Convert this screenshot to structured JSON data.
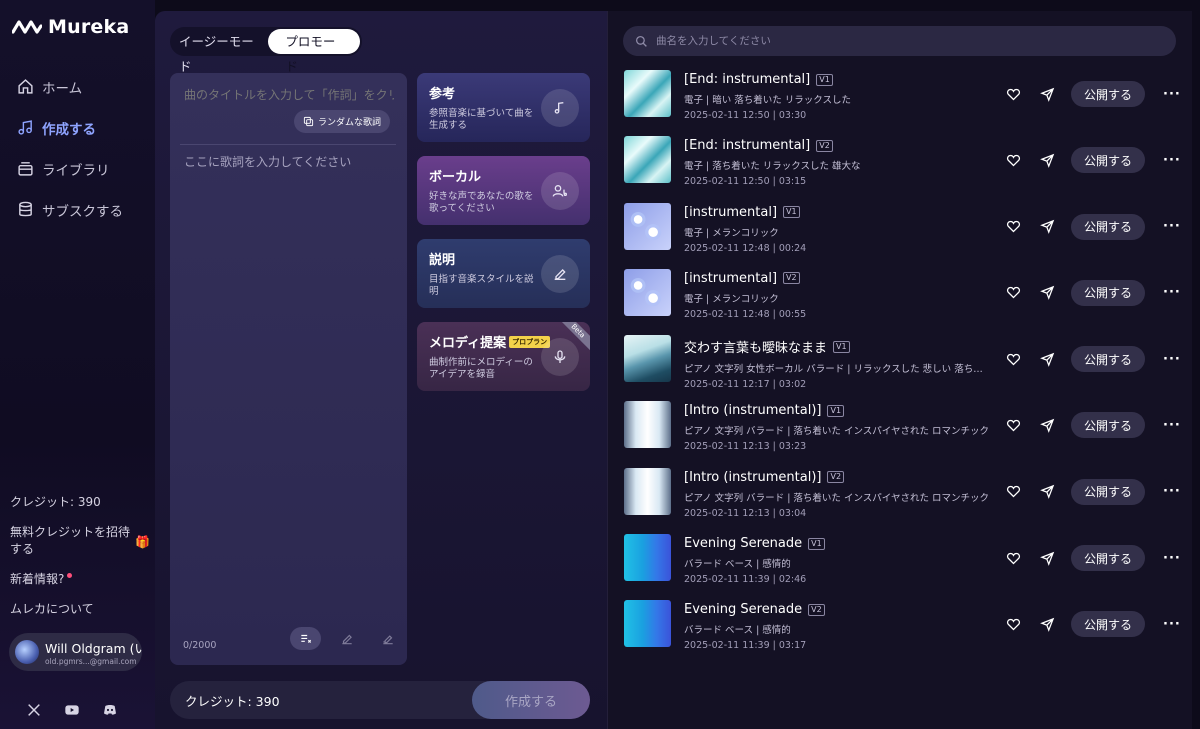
{
  "brand": {
    "name": "Mureka"
  },
  "nav": [
    {
      "label": "ホーム",
      "icon": "home-icon"
    },
    {
      "label": "作成する",
      "icon": "music-note-icon",
      "active": true
    },
    {
      "label": "ライブラリ",
      "icon": "library-icon"
    },
    {
      "label": "サブスクする",
      "icon": "database-icon"
    }
  ],
  "sidebar_bottom": {
    "credits": "クレジット: 390",
    "invite": "無料クレジットを招待する",
    "news": "新着情報?",
    "about": "ムレカについて",
    "user_name": "Will Oldgram (い",
    "user_email": "old.pgmrs...@gmail.com"
  },
  "modes": {
    "easy": "イージーモード",
    "pro": "プロモード"
  },
  "lyrics": {
    "title_placeholder": "曲のタイトルを入力して「作詞」をクリック",
    "random_button": "ランダムな歌詞",
    "lyrics_placeholder": "ここに歌詞を入力してください",
    "char_count": "0/2000"
  },
  "cards": [
    {
      "title": "参考",
      "desc": "参照音楽に基づいて曲を生成する",
      "icon": "music-note-icon"
    },
    {
      "title": "ボーカル",
      "desc": "好きな声であなたの歌を歌ってください",
      "icon": "vocal-icon"
    },
    {
      "title": "説明",
      "desc": "目指す音楽スタイルを説明",
      "icon": "pen-icon"
    },
    {
      "title": "メロディ提案",
      "badge": "プロプラン",
      "ribbon": "Beta",
      "desc": "曲制作前にメロディーのアイデアを録音",
      "icon": "mic-icon"
    }
  ],
  "footer": {
    "credits": "クレジット: 390",
    "create": "作成する"
  },
  "search": {
    "placeholder": "曲名を入力してください"
  },
  "tracks": [
    {
      "title": "[End: instrumental]",
      "ver": "V1",
      "tags": "電子 | 暗い 落ち着いた リラックスした",
      "meta": "2025-02-11 12:50 | 03:30",
      "publish": "公開する",
      "thumb": "teal"
    },
    {
      "title": "[End: instrumental]",
      "ver": "V2",
      "tags": "電子 | 落ち着いた リラックスした 雄大な",
      "meta": "2025-02-11 12:50 | 03:15",
      "publish": "公開する",
      "thumb": "teal"
    },
    {
      "title": "[instrumental]",
      "ver": "V1",
      "tags": "電子 | メランコリック",
      "meta": "2025-02-11 12:48 | 00:24",
      "publish": "公開する",
      "thumb": "bubble"
    },
    {
      "title": "[instrumental]",
      "ver": "V2",
      "tags": "電子 | メランコリック",
      "meta": "2025-02-11 12:48 | 00:55",
      "publish": "公開する",
      "thumb": "bubble"
    },
    {
      "title": "交わす言葉も曖昧なまま",
      "ver": "V1",
      "tags": "ピアノ 文字列 女性ボーカル バラード | リラックスした 悲しい 落ち着いた",
      "meta": "2025-02-11 12:17 | 03:02",
      "publish": "公開する",
      "thumb": "whale"
    },
    {
      "title": "[Intro (instrumental)]",
      "ver": "V1",
      "tags": "ピアノ 文字列 バラード | 落ち着いた インスパイヤされた ロマンチック",
      "meta": "2025-02-11 12:13 | 03:23",
      "publish": "公開する",
      "thumb": "hall"
    },
    {
      "title": "[Intro (instrumental)]",
      "ver": "V2",
      "tags": "ピアノ 文字列 バラード | 落ち着いた インスパイヤされた ロマンチック",
      "meta": "2025-02-11 12:13 | 03:04",
      "publish": "公開する",
      "thumb": "hall"
    },
    {
      "title": "Evening Serenade",
      "ver": "V1",
      "tags": "バラード ベース | 感情的",
      "meta": "2025-02-11 11:39 | 02:46",
      "publish": "公開する",
      "thumb": "blue"
    },
    {
      "title": "Evening Serenade",
      "ver": "V2",
      "tags": "バラード ベース | 感情的",
      "meta": "2025-02-11 11:39 | 03:17",
      "publish": "公開する",
      "thumb": "blue"
    }
  ],
  "socials": [
    "x-icon",
    "youtube-icon",
    "discord-icon"
  ]
}
